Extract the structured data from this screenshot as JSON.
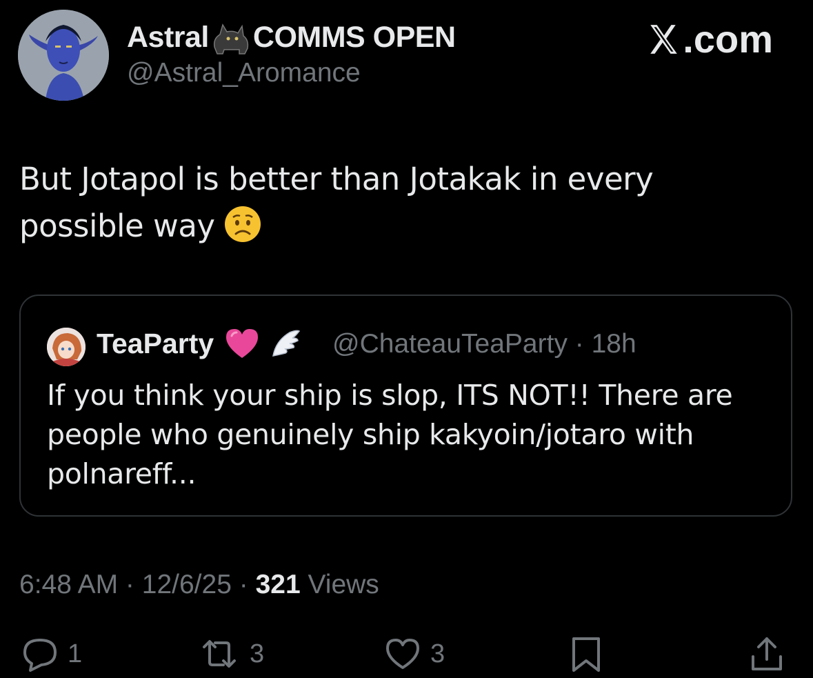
{
  "author": {
    "display_name": "Astral",
    "name_suffix": "COMMS OPEN",
    "handle": "@Astral_Aromance",
    "avatar_icon": "blue-elf-avatar"
  },
  "brand": {
    "label": ".com",
    "logo_icon": "x-logo-icon"
  },
  "tweet": {
    "text": "But Jotapol is better than Jotakak in every possible way",
    "emoji_icon": "worried-face-emoji"
  },
  "quote": {
    "display_name": "TeaParty",
    "handle_time": "@ChateauTeaParty · 18h",
    "text": "If you think your ship is slop, ITS NOT!! There are people who genuinely ship kakyoin/jotaro with polnareff...",
    "badges": [
      "pink-heart-emoji",
      "angel-wing-emoji"
    ]
  },
  "meta": {
    "time": "6:48 AM",
    "sep1": " · ",
    "date": "12/6/25",
    "sep2": " · ",
    "views_count": "321",
    "views_label": " Views"
  },
  "actions": {
    "replies": "1",
    "reposts": "3",
    "likes": "3"
  },
  "colors": {
    "background": "#000000",
    "text": "#e7e9ea",
    "muted": "#71767b",
    "border": "#2f3336"
  }
}
